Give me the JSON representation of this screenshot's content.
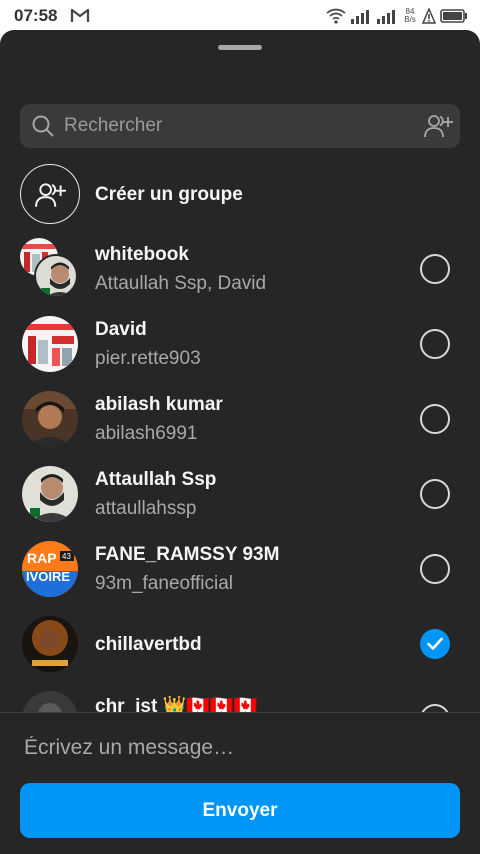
{
  "status_bar": {
    "time": "07:58",
    "net_speed_value": "84",
    "net_speed_unit": "B/s",
    "icons": [
      "gmail-icon",
      "wifi-icon",
      "signal-icon",
      "signal-icon",
      "alert-icon",
      "battery-icon"
    ]
  },
  "search": {
    "placeholder": "Rechercher"
  },
  "create_group": {
    "label": "Créer un groupe"
  },
  "recipients": [
    {
      "name": "whitebook",
      "subtitle": "Attaullah Ssp, David",
      "selected": false
    },
    {
      "name": "David",
      "subtitle": "pier.rette903",
      "selected": false
    },
    {
      "name": "abilash kumar",
      "subtitle": "abilash6991",
      "selected": false
    },
    {
      "name": "Attaullah Ssp",
      "subtitle": "attaullahssp",
      "selected": false
    },
    {
      "name": "FANE_RAMSSY 93M",
      "subtitle": "93m_faneofficial",
      "selected": false
    },
    {
      "name": "chillavertbd",
      "subtitle": "",
      "selected": true
    },
    {
      "name": "chr_ist 👑🇨🇦🇨🇦🇨🇦",
      "subtitle": "",
      "selected": false
    }
  ],
  "avatar_texts": {
    "ivoire_line1": "RAP",
    "ivoire_line2": "IVOIRE",
    "ivoire_badge": "43"
  },
  "message": {
    "placeholder": "Écrivez un message…"
  },
  "send_button": {
    "label": "Envoyer"
  },
  "colors": {
    "sheet_bg": "#262626",
    "accent": "#0095f6",
    "search_bg": "#3a3a3a"
  }
}
